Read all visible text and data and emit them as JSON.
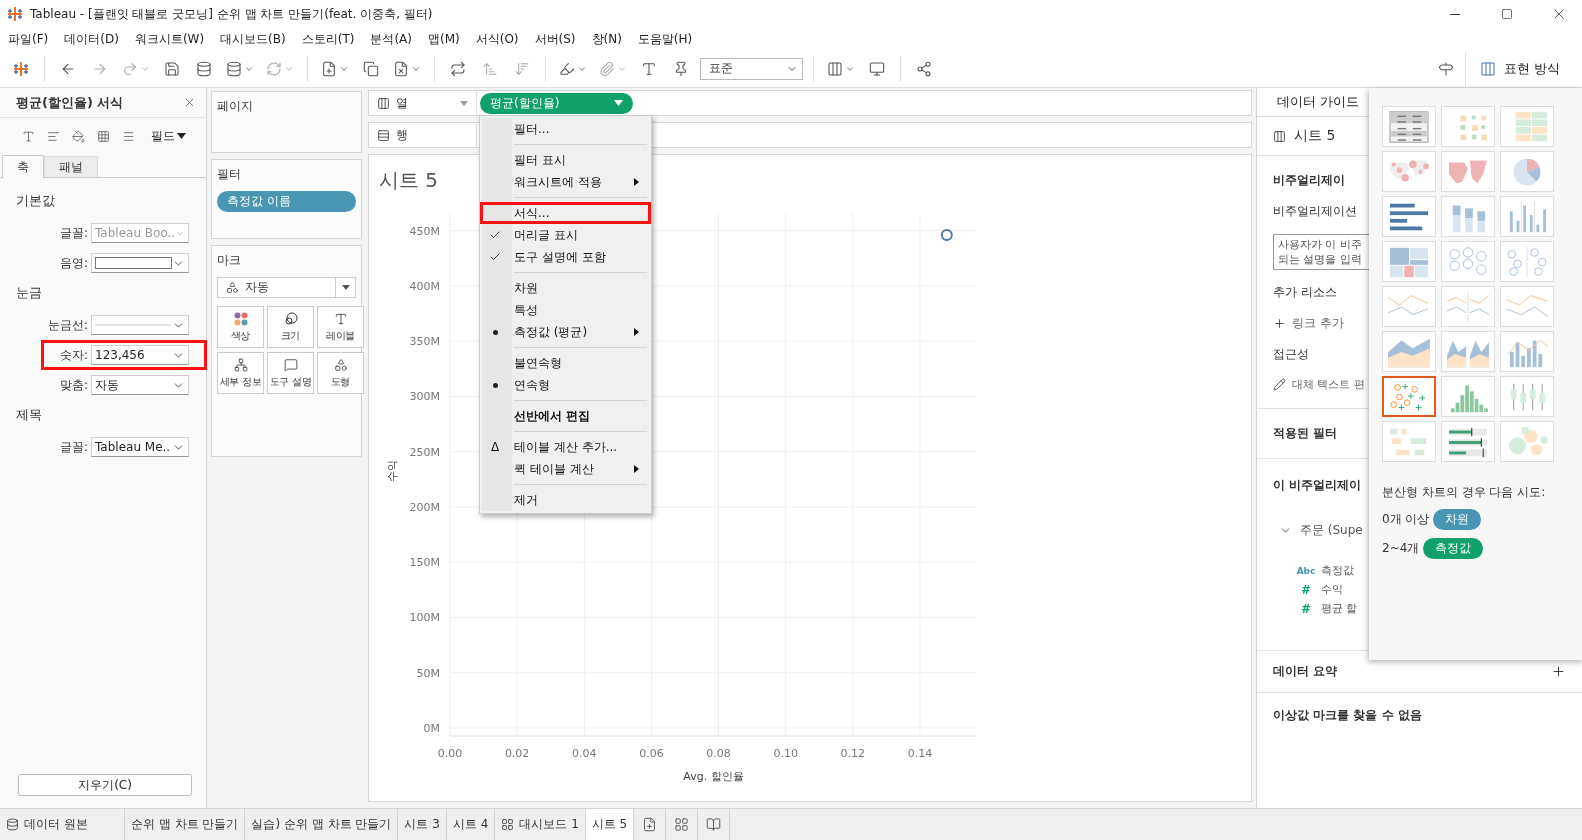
{
  "window": {
    "title": "Tableau - [플랜잇 태블로 굿모닝] 순위 맵 차트 만들기(feat. 이중축, 필터)"
  },
  "menu_bar": [
    "파일(F)",
    "데이터(D)",
    "워크시트(W)",
    "대시보드(B)",
    "스토리(T)",
    "분석(A)",
    "맵(M)",
    "서식(O)",
    "서버(S)",
    "창(N)",
    "도움말(H)"
  ],
  "toolbar": {
    "presentation_select": "표준",
    "show_me_button": "표현 방식"
  },
  "format_pane": {
    "title": "평균(할인율) 서식",
    "scope": "필드",
    "tabs": [
      {
        "label": "축",
        "selected": true
      },
      {
        "label": "패널",
        "selected": false
      }
    ],
    "sections": [
      {
        "title": "기본값",
        "rows": [
          {
            "label": "글꼴:",
            "kind": "text",
            "value": "Tableau Boo..",
            "dimmed": true,
            "highlighted": false
          },
          {
            "label": "음영:",
            "kind": "swatch",
            "highlighted": false
          }
        ]
      },
      {
        "title": "눈금",
        "rows": [
          {
            "label": "눈금선:",
            "kind": "line",
            "highlighted": false
          },
          {
            "label": "숫자:",
            "kind": "text",
            "value": "123,456",
            "dimmed": false,
            "highlighted": true
          },
          {
            "label": "맞춤:",
            "kind": "text",
            "value": "자동",
            "dimmed": false,
            "highlighted": false
          }
        ]
      },
      {
        "title": "제목",
        "rows": [
          {
            "label": "글꼴:",
            "kind": "text",
            "value": "Tableau Me..",
            "dimmed": false,
            "highlighted": false
          }
        ]
      }
    ],
    "clear_button": "지우기(C)"
  },
  "shelves": {
    "pages": {
      "title": "페이지"
    },
    "filters": {
      "title": "필터",
      "pills": [
        {
          "label": "측정값 이름",
          "kind": "dimension"
        }
      ]
    },
    "marks": {
      "title": "마크",
      "type": "자동",
      "buttons": [
        {
          "label": "색상",
          "kind": "color"
        },
        {
          "label": "크기",
          "kind": "size"
        },
        {
          "label": "레이블",
          "kind": "label"
        },
        {
          "label": "세부 정보",
          "kind": "detail"
        },
        {
          "label": "도구 설명",
          "kind": "tooltip"
        },
        {
          "label": "도형",
          "kind": "shape"
        }
      ]
    }
  },
  "columns_shelf": {
    "label": "열",
    "pills": [
      {
        "label": "평균(할인율)",
        "kind": "measure"
      }
    ]
  },
  "rows_shelf": {
    "label": "행"
  },
  "context_menu": {
    "groups": [
      [
        {
          "label": "필터...",
          "kind": "action",
          "submenu": false,
          "bold": false,
          "highlighted": false
        }
      ],
      [
        {
          "label": "필터 표시",
          "kind": "action",
          "submenu": false,
          "bold": false,
          "highlighted": false
        },
        {
          "label": "워크시트에 적용",
          "kind": "action",
          "submenu": true,
          "bold": false,
          "highlighted": false
        }
      ],
      [
        {
          "label": "서식...",
          "kind": "action",
          "submenu": false,
          "bold": false,
          "highlighted": true
        },
        {
          "label": "머리글 표시",
          "kind": "check",
          "checked": true,
          "submenu": false,
          "bold": false,
          "highlighted": false
        },
        {
          "label": "도구 설명에 포함",
          "kind": "check",
          "checked": true,
          "submenu": false,
          "bold": false,
          "highlighted": false
        }
      ],
      [
        {
          "label": "차원",
          "kind": "radio",
          "selected": false,
          "submenu": false,
          "bold": false,
          "highlighted": false
        },
        {
          "label": "특성",
          "kind": "radio",
          "selected": false,
          "submenu": false,
          "bold": false,
          "highlighted": false
        },
        {
          "label": "측정값 (평균)",
          "kind": "radio",
          "selected": true,
          "submenu": true,
          "bold": false,
          "highlighted": false
        }
      ],
      [
        {
          "label": "불연속형",
          "kind": "radio",
          "selected": false,
          "submenu": false,
          "bold": false,
          "highlighted": false
        },
        {
          "label": "연속형",
          "kind": "radio",
          "selected": true,
          "submenu": false,
          "bold": false,
          "highlighted": false
        }
      ],
      [
        {
          "label": "선반에서 편집",
          "kind": "action",
          "submenu": false,
          "bold": true,
          "highlighted": false
        }
      ],
      [
        {
          "label": "테이블 계산 추가...",
          "kind": "action",
          "marker": "Δ",
          "submenu": false,
          "bold": false,
          "highlighted": false
        },
        {
          "label": "퀵 테이블 계산",
          "kind": "action",
          "submenu": true,
          "bold": false,
          "highlighted": false
        }
      ],
      [
        {
          "label": "제거",
          "kind": "action",
          "submenu": false,
          "bold": false,
          "highlighted": false
        }
      ]
    ]
  },
  "sheet": {
    "title": "시트 5",
    "chart_data": {
      "type": "scatter",
      "grid": true,
      "xlabel": "Avg. 할인율",
      "ylabel": "수익",
      "xlim": [
        0,
        0.157
      ],
      "ylim": [
        0,
        466000000
      ],
      "xticks": [
        {
          "value": 0,
          "label": "0.00"
        },
        {
          "value": 0.02,
          "label": "0.02"
        },
        {
          "value": 0.04,
          "label": "0.04"
        },
        {
          "value": 0.06,
          "label": "0.06"
        },
        {
          "value": 0.08,
          "label": "0.08"
        },
        {
          "value": 0.1,
          "label": "0.10"
        },
        {
          "value": 0.12,
          "label": "0.12"
        },
        {
          "value": 0.14,
          "label": "0.14"
        }
      ],
      "yticks": [
        {
          "value": 0,
          "label": "0M"
        },
        {
          "value": 50000000,
          "label": "50M"
        },
        {
          "value": 100000000,
          "label": "100M"
        },
        {
          "value": 150000000,
          "label": "150M"
        },
        {
          "value": 200000000,
          "label": "200M"
        },
        {
          "value": 250000000,
          "label": "250M"
        },
        {
          "value": 300000000,
          "label": "300M"
        },
        {
          "value": 350000000,
          "label": "350M"
        },
        {
          "value": 400000000,
          "label": "400M"
        },
        {
          "value": 450000000,
          "label": "450M"
        }
      ],
      "x": [
        0.148
      ],
      "series": [
        {
          "color": "#4e79a7",
          "values": [
            446000000
          ]
        }
      ]
    }
  },
  "data_guide": {
    "tab": "데이터 가이드",
    "sheet_name": "시트 5",
    "viz_heading": "비주얼리제이",
    "description_label": "비주얼리제이션",
    "description_lines": [
      "사용자가 이 비주",
      "되는 설명을 입력"
    ],
    "resources_label": "추가 리소스",
    "add_link": "링크 추가",
    "accessibility_label": "접근성",
    "alt_text": "대체 텍스트 편",
    "filters_heading": "적용된 필터",
    "fields_heading": "이 비주얼리제이",
    "datasource": {
      "name": "주문 (Supe",
      "expanded": true,
      "fields": [
        {
          "type": "Abc",
          "kind": "dimension",
          "name": "측정값"
        },
        {
          "type": "#",
          "kind": "measure",
          "name": "수익"
        },
        {
          "type": "#",
          "kind": "measure",
          "name": "평균 할"
        }
      ]
    },
    "summary_heading": "데이터 요약",
    "outliers": "이상값 마크를 찾을 수 없음"
  },
  "show_me": {
    "thumbnails": [
      {
        "kind": "text-table",
        "selected": false
      },
      {
        "kind": "heat-map",
        "selected": false
      },
      {
        "kind": "highlight-table",
        "selected": false
      },
      {
        "kind": "symbol-map",
        "selected": false
      },
      {
        "kind": "filled-map",
        "selected": false
      },
      {
        "kind": "pie",
        "selected": false
      },
      {
        "kind": "horizontal-bars",
        "selected": false
      },
      {
        "kind": "stacked-bars",
        "selected": false
      },
      {
        "kind": "side-by-side-bars",
        "selected": false
      },
      {
        "kind": "treemap",
        "selected": false
      },
      {
        "kind": "circle-view",
        "selected": false
      },
      {
        "kind": "side-by-side-circles",
        "selected": false
      },
      {
        "kind": "lines-continuous",
        "selected": false
      },
      {
        "kind": "lines-discrete",
        "selected": false
      },
      {
        "kind": "dual-lines",
        "selected": false
      },
      {
        "kind": "area-continuous",
        "selected": false
      },
      {
        "kind": "area-discrete",
        "selected": false
      },
      {
        "kind": "dual-combination",
        "selected": false
      },
      {
        "kind": "scatter",
        "selected": true
      },
      {
        "kind": "histogram",
        "selected": false
      },
      {
        "kind": "box-whisker",
        "selected": false
      },
      {
        "kind": "gantt",
        "selected": false
      },
      {
        "kind": "bullet",
        "selected": false
      },
      {
        "kind": "packed-bubbles",
        "selected": false
      }
    ],
    "hint": "분산형 차트의 경우 다음 시도:",
    "requirements": [
      {
        "count": "0개 이상",
        "pill": "차원",
        "kind": "dimension"
      },
      {
        "count": "2~4개",
        "pill": "측정값",
        "kind": "measure"
      }
    ]
  },
  "sheet_tabs": [
    {
      "label": "데이터 원본",
      "kind": "datasource",
      "selected": false
    },
    {
      "label": "순위 맵 차트 만들기",
      "kind": "sheet",
      "selected": false
    },
    {
      "label": "실습) 순위 맵 차트 만들기",
      "kind": "sheet",
      "selected": false
    },
    {
      "label": "시트 3",
      "kind": "sheet",
      "selected": false
    },
    {
      "label": "시트 4",
      "kind": "sheet",
      "selected": false
    },
    {
      "label": "대시보드 1",
      "kind": "dashboard",
      "selected": false
    },
    {
      "label": "시트 5",
      "kind": "sheet",
      "selected": true
    }
  ]
}
